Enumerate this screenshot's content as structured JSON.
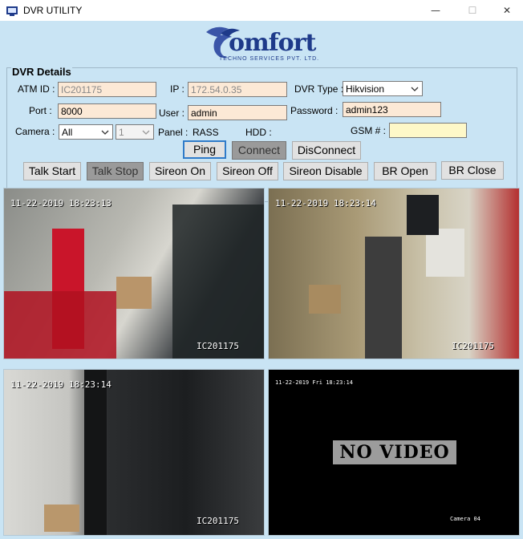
{
  "window": {
    "title": "DVR UTILITY",
    "minimize_glyph": "—",
    "maximize_glyph": "☐",
    "close_glyph": "✕"
  },
  "logo": {
    "brand": "omfort",
    "tagline": "TECHNO SERVICES PVT. LTD.",
    "colors": {
      "primary": "#1e3a8a",
      "wing": "#3a55a8"
    }
  },
  "dvr_details": {
    "group_title": "DVR Details",
    "atm_id": {
      "label": "ATM ID :",
      "value": "IC201175"
    },
    "ip": {
      "label": "IP :",
      "value": "172.54.0.35"
    },
    "dvr_type": {
      "label": "DVR Type :",
      "value": "Hikvision"
    },
    "port": {
      "label": "Port :",
      "value": "8000"
    },
    "user": {
      "label": "User :",
      "value": "admin"
    },
    "password": {
      "label": "Password :",
      "value": "admin123"
    },
    "camera": {
      "label": "Camera :",
      "value": "All",
      "channel": "1"
    },
    "panel": {
      "label": "Panel :",
      "value": "RASS"
    },
    "hdd": {
      "label": "HDD :",
      "value": ""
    },
    "gsm": {
      "label": "GSM # :",
      "value": ""
    }
  },
  "buttons": {
    "ping": "Ping",
    "connect": "Connect",
    "disconnect": "DisConnect",
    "talk_start": "Talk Start",
    "talk_stop": "Talk Stop",
    "siren_on": "Sireon On",
    "siren_off": "Sireon Off",
    "siren_disable": "Sireon Disable",
    "br_open": "BR Open",
    "br_close": "BR Close"
  },
  "video_feeds": [
    {
      "timestamp": "11-22-2019 18:23:13",
      "camera_id": "IC201175"
    },
    {
      "timestamp": "11-22-2019 18:23:14",
      "camera_id": "IC201175"
    },
    {
      "timestamp": "11-22-2019 18:23:14",
      "camera_id": "IC201175"
    },
    {
      "timestamp": "11-22-2019 Fri 18:23:14",
      "no_video_text": "NO VIDEO",
      "camera_label": "Camera 04"
    }
  ],
  "colors": {
    "client_bg": "#c9e4f4",
    "field_bg": "#fce9d6",
    "gsm_field_bg": "#fef8c8",
    "focus_border": "#2f7bc9"
  }
}
